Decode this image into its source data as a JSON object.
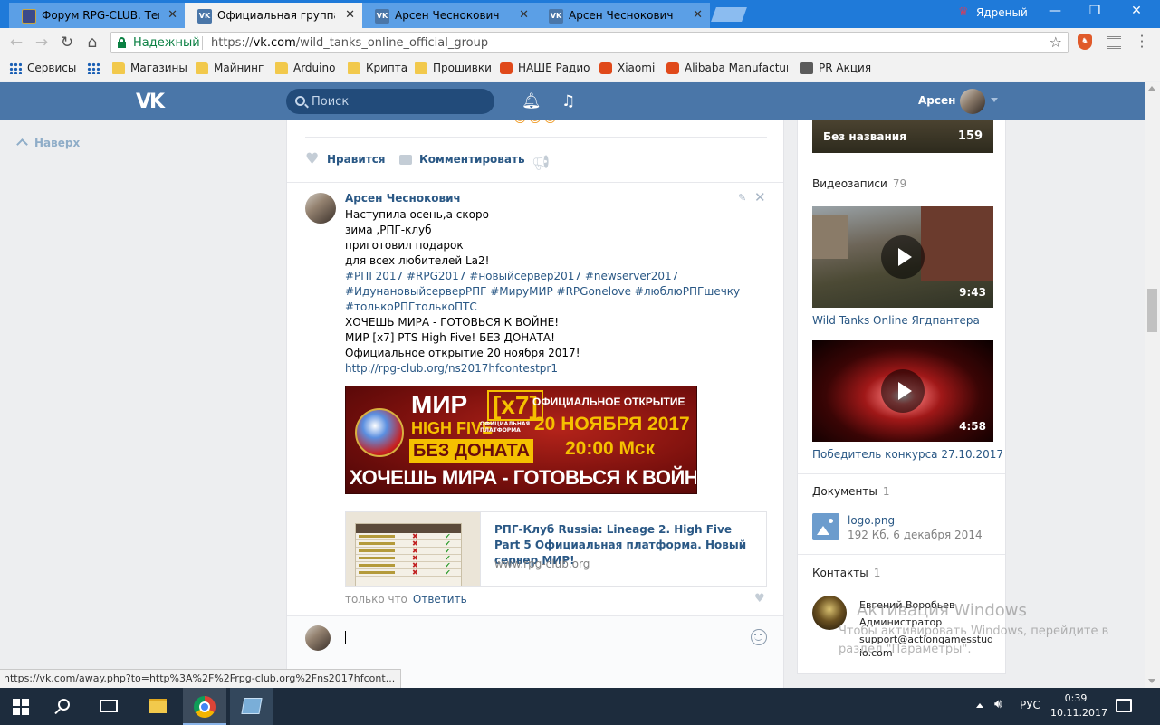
{
  "browser": {
    "tabs": [
      {
        "label": "Форум RPG-CLUB. Тема",
        "favicon": "rpg-club-favicon",
        "active": false
      },
      {
        "label": "Официальная группа иг",
        "favicon": "vk-favicon",
        "active": true
      },
      {
        "label": "Арсен Чеснокович",
        "favicon": "vk-favicon",
        "active": false
      },
      {
        "label": "Арсен Чеснокович",
        "favicon": "vk-favicon",
        "active": false
      }
    ],
    "profile_name": "Ядреный",
    "security_label": "Надежный",
    "url_scheme": "https://",
    "url_host": "vk.com",
    "url_path": "/wild_tanks_online_official_group",
    "bookmarks": [
      {
        "label": "Сервисы",
        "icon": "apps-grid-icon"
      },
      {
        "label": "Магазины",
        "icon": "folder-icon"
      },
      {
        "label": "Майнинг",
        "icon": "folder-icon"
      },
      {
        "label": "Arduino",
        "icon": "folder-icon"
      },
      {
        "label": "Крипта",
        "icon": "folder-icon"
      },
      {
        "label": "Прошивки",
        "icon": "folder-icon"
      },
      {
        "label": "НАШЕ Радио",
        "icon": "nashe-radio-icon"
      },
      {
        "label": "Xiaomi",
        "icon": "xiaomi-icon"
      },
      {
        "label": "Alibaba Manufacturer",
        "icon": "alibaba-icon"
      },
      {
        "label": "PR Акция",
        "icon": "rpg-club-icon"
      }
    ],
    "status_url": "https://vk.com/away.php?to=http%3A%2F%2Frpg-club.org%2Fns2017hfcont..."
  },
  "vk": {
    "search_placeholder": "Поиск",
    "user_name": "Арсен",
    "back_to_top": "Наверх",
    "post_actions": {
      "like": "Нравится",
      "comment": "Комментировать"
    },
    "comment": {
      "author": "Арсен Чеснокович",
      "lines": [
        {
          "text": "Наступила осень,а скоро",
          "tag": false
        },
        {
          "text": "зима ,РПГ-клуб",
          "tag": false
        },
        {
          "text": "приготовил подарок",
          "tag": false
        },
        {
          "text": "для всех любителей La2!",
          "tag": false
        },
        {
          "text": "#РПГ2017 #RPG2017 #новыйсервер2017 #newserver2017",
          "tag": true
        },
        {
          "text": "#ИдунановыйсерверРПГ #МируМИР #RPGonelove #люблюРПГшечку",
          "tag": true
        },
        {
          "text": "#толькоРПГтолькоПТС",
          "tag": true
        },
        {
          "text": "ХОЧЕШЬ МИРА - ГОТОВЬСЯ К ВОЙНЕ!",
          "tag": false
        },
        {
          "text": "МИР [x7] PTS High Five! БЕЗ ДОНАТА!",
          "tag": false
        },
        {
          "text": "Официальное открытие 20 ноября 2017!",
          "tag": false
        },
        {
          "text": "http://rpg-club.org/ns2017hfcontestpr1",
          "tag": true
        }
      ],
      "banner": {
        "mir": "МИР",
        "x7": "[x7]",
        "high_five": "HIGH FIVE",
        "platform": "ОФИЦИАЛЬНАЯ ПЛАТФОРМА",
        "no_donate": "БЕЗ ДОНАТА",
        "official_opening": "ОФИЦИАЛЬНОЕ ОТКРЫТИЕ",
        "date": "20 НОЯБРЯ 2017",
        "time": "20:00 Мск",
        "slogan": "ХОЧЕШЬ МИРА - ГОТОВЬСЯ К ВОЙНЕ"
      },
      "link_card": {
        "title": "РПГ-Клуб Russia: Lineage 2. High Five Part 5 Официальная платформа. Новый сервер МИР!",
        "domain": "www.rpg-club.org"
      },
      "time": "только что",
      "reply": "Ответить"
    }
  },
  "sidebar": {
    "album": {
      "name": "Без названия",
      "count": "159"
    },
    "videos": {
      "header": "Видеозаписи",
      "count": "79",
      "items": [
        {
          "title": "Wild Tanks Online Ягдпантера",
          "duration": "9:43"
        },
        {
          "title": "Победитель конкурса 27.10.2017",
          "duration": "4:58"
        }
      ]
    },
    "documents": {
      "header": "Документы",
      "count": "1",
      "file_name": "logo.png",
      "file_meta": "192 Кб, 6 декабря 2014"
    },
    "contacts": {
      "header": "Контакты",
      "count": "1",
      "name": "Евгений Воробьев",
      "role": "Администратор",
      "email": "support@actiongamesstudio.com"
    }
  },
  "watermark": {
    "title": "Активация Windows",
    "line1": "Чтобы активировать Windows, перейдите в",
    "line2": "раздел \"Параметры\"."
  },
  "taskbar": {
    "language": "РУС",
    "time": "0:39",
    "date": "10.11.2017"
  }
}
